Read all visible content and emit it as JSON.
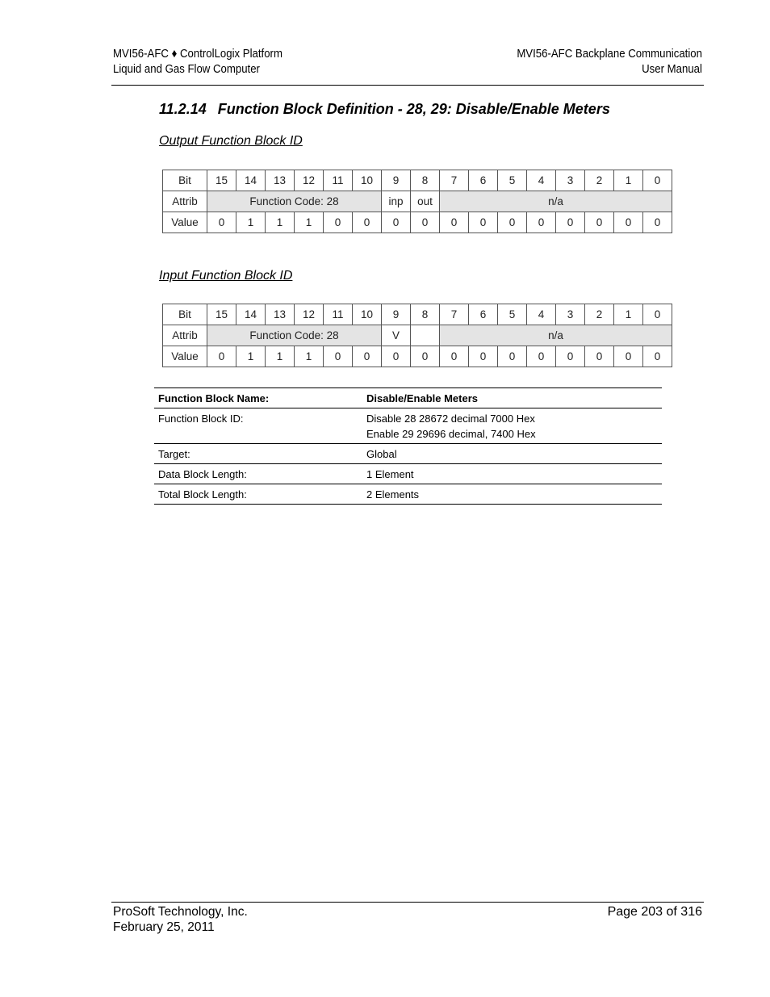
{
  "header": {
    "left_line1": "MVI56-AFC ♦ ControlLogix Platform",
    "left_line2": "Liquid and Gas Flow Computer",
    "right_line1": "MVI56-AFC Backplane Communication",
    "right_line2": "User Manual"
  },
  "section": {
    "number": "11.2.14",
    "title": "Function Block Definition - 28, 29: Disable/Enable Meters"
  },
  "output_block": {
    "heading": "Output Function Block ID",
    "row_labels": {
      "bit": "Bit",
      "attrib": "Attrib",
      "value": "Value"
    },
    "bits": [
      "15",
      "14",
      "13",
      "12",
      "11",
      "10",
      "9",
      "8",
      "7",
      "6",
      "5",
      "4",
      "3",
      "2",
      "1",
      "0"
    ],
    "attrib": {
      "function_code": "Function Code: 28",
      "bit9": "inp",
      "bit8": "out",
      "low": "n/a"
    },
    "values": [
      "0",
      "1",
      "1",
      "1",
      "0",
      "0",
      "0",
      "0",
      "0",
      "0",
      "0",
      "0",
      "0",
      "0",
      "0",
      "0"
    ]
  },
  "input_block": {
    "heading": "Input Function Block ID",
    "row_labels": {
      "bit": "Bit",
      "attrib": "Attrib",
      "value": "Value"
    },
    "bits": [
      "15",
      "14",
      "13",
      "12",
      "11",
      "10",
      "9",
      "8",
      "7",
      "6",
      "5",
      "4",
      "3",
      "2",
      "1",
      "0"
    ],
    "attrib": {
      "function_code": "Function Code: 28",
      "bit9": "V",
      "bit8": "",
      "low": "n/a"
    },
    "values": [
      "0",
      "1",
      "1",
      "1",
      "0",
      "0",
      "0",
      "0",
      "0",
      "0",
      "0",
      "0",
      "0",
      "0",
      "0",
      "0"
    ]
  },
  "info_table": {
    "rows": [
      {
        "key": "Function Block Name:",
        "value": "Disable/Enable Meters"
      },
      {
        "key": "Function Block ID:",
        "value": "Disable 28 28672 decimal 7000 Hex",
        "value2": "Enable 29 29696 decimal, 7400 Hex"
      },
      {
        "key": "Target:",
        "value": "Global"
      },
      {
        "key": "Data Block Length:",
        "value": "1 Element"
      },
      {
        "key": "Total Block Length:",
        "value": "2 Elements"
      }
    ]
  },
  "footer": {
    "company": "ProSoft Technology, Inc.",
    "date": "February 25, 2011",
    "page": "Page 203 of 316"
  }
}
